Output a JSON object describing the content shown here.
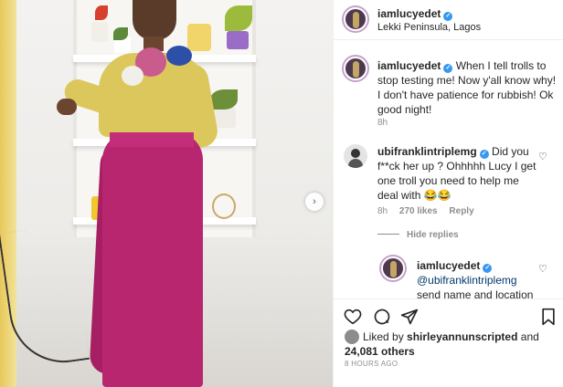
{
  "post": {
    "author": "iamlucyedet",
    "location": "Lekki Peninsula, Lagos"
  },
  "caption": {
    "author": "iamlucyedet",
    "text": "When I tell trolls to stop testing me! Now y'all know why! I don't have patience for rubbish! Ok good night!",
    "age": "8h"
  },
  "comments": [
    {
      "author": "ubifranklintriplemg",
      "text": "Did you f**ck her up ? Ohhhhh Lucy I get one troll you need to help me deal with 😂😂",
      "age": "8h",
      "likes": "270 likes",
      "reply_label": "Reply"
    }
  ],
  "hide_replies_label": "Hide replies",
  "reply": {
    "author": "iamlucyedet",
    "mention": "@ubifranklintriplemg",
    "text": "send name and location"
  },
  "likes": {
    "prefix": "Liked by",
    "user": "shirleyannunscripted",
    "and": "and",
    "others": "24,081 others"
  },
  "timestamp": "8 HOURS AGO",
  "icons": {
    "like": "heart-icon",
    "comment": "comment-icon",
    "share": "share-icon",
    "save": "bookmark-icon",
    "next": "chevron-right-icon"
  },
  "colors": {
    "verified": "#3897f0",
    "mention": "#00376b",
    "muted": "#8e8e8e"
  }
}
